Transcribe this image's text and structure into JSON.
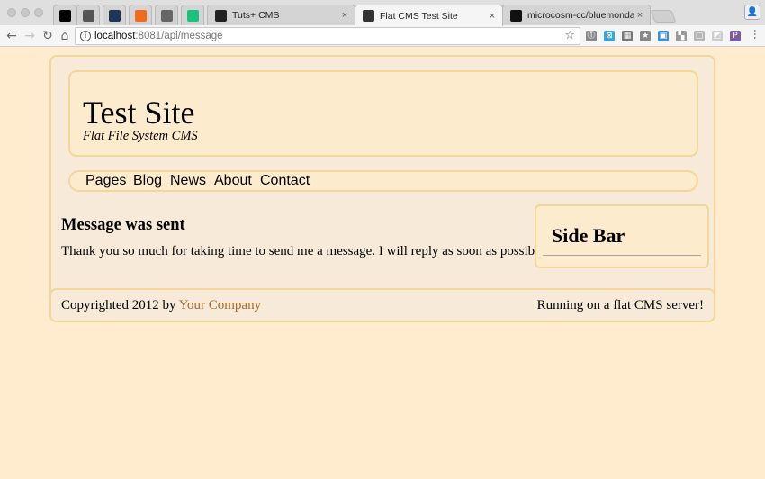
{
  "browser": {
    "tabs": [
      {
        "label": "",
        "icon": "podcast-icon",
        "color": "#000000",
        "pinned": true
      },
      {
        "label": "",
        "icon": "notebook-icon",
        "color": "#555555",
        "pinned": true
      },
      {
        "label": "",
        "icon": "analytics-icon",
        "color": "#1d3557",
        "pinned": true
      },
      {
        "label": "",
        "icon": "link-icon",
        "color": "#f26b1d",
        "pinned": true
      },
      {
        "label": "",
        "icon": "book-icon",
        "color": "#666666",
        "pinned": true
      },
      {
        "label": "",
        "icon": "medium-icon",
        "color": "#19c37d",
        "pinned": true
      },
      {
        "label": "Tuts+ CMS",
        "icon": "tuts-icon",
        "color": "#222222"
      },
      {
        "label": "Flat CMS Test Site",
        "icon": "hammer-icon",
        "color": "#333333",
        "active": true
      },
      {
        "label": "microcosm-cc/bluemonday: bl",
        "icon": "github-icon",
        "color": "#111111"
      }
    ],
    "close_glyph": "×",
    "address": {
      "host": "localhost",
      "path": ":8081/api/message"
    },
    "info_glyph": "i",
    "star_glyph": "☆",
    "extensions": [
      {
        "name": "1password-ext-icon",
        "glyph": "⓵",
        "color": "#888888"
      },
      {
        "name": "box-ext-icon",
        "glyph": "⊠",
        "color": "#3aa3d8"
      },
      {
        "name": "store-ext-icon",
        "glyph": "▦",
        "color": "#777777"
      },
      {
        "name": "star-ext-icon",
        "glyph": "★",
        "color": "#888888"
      },
      {
        "name": "trello-ext-icon",
        "glyph": "▣",
        "color": "#3d8fd2"
      },
      {
        "name": "reader-ext-icon",
        "glyph": "▚",
        "color": "#999999"
      },
      {
        "name": "page-ext-icon",
        "glyph": "▢",
        "color": "#b5b5b5"
      },
      {
        "name": "corner-ext-icon",
        "glyph": "◩",
        "color": "#cccccc"
      },
      {
        "name": "pocket-ext-icon",
        "glyph": "P",
        "color": "#7a5ca3"
      }
    ],
    "back_glyph": "←",
    "forward_glyph": "→",
    "reload_glyph": "↻",
    "home_glyph": "⌂",
    "menu_glyph": "⋯",
    "profile_glyph": "👤"
  },
  "site": {
    "title": "Test Site",
    "subtitle": "Flat File System CMS",
    "nav": [
      "Pages",
      "Blog",
      "News",
      "About",
      "Contact"
    ],
    "message_title": "Message was sent",
    "message_body": "Thank you so much for taking time to send me a message. I will reply as soon as possible.",
    "sidebar_title": "Side Bar",
    "footer_left_prefix": "Copyrighted 2012 by ",
    "footer_link": "Your Company",
    "footer_right": "Running on a flat CMS server!"
  },
  "colors": {
    "page_bg": "#ffeccf",
    "box_border": "#f4d59c",
    "link": "#a66a2a"
  }
}
